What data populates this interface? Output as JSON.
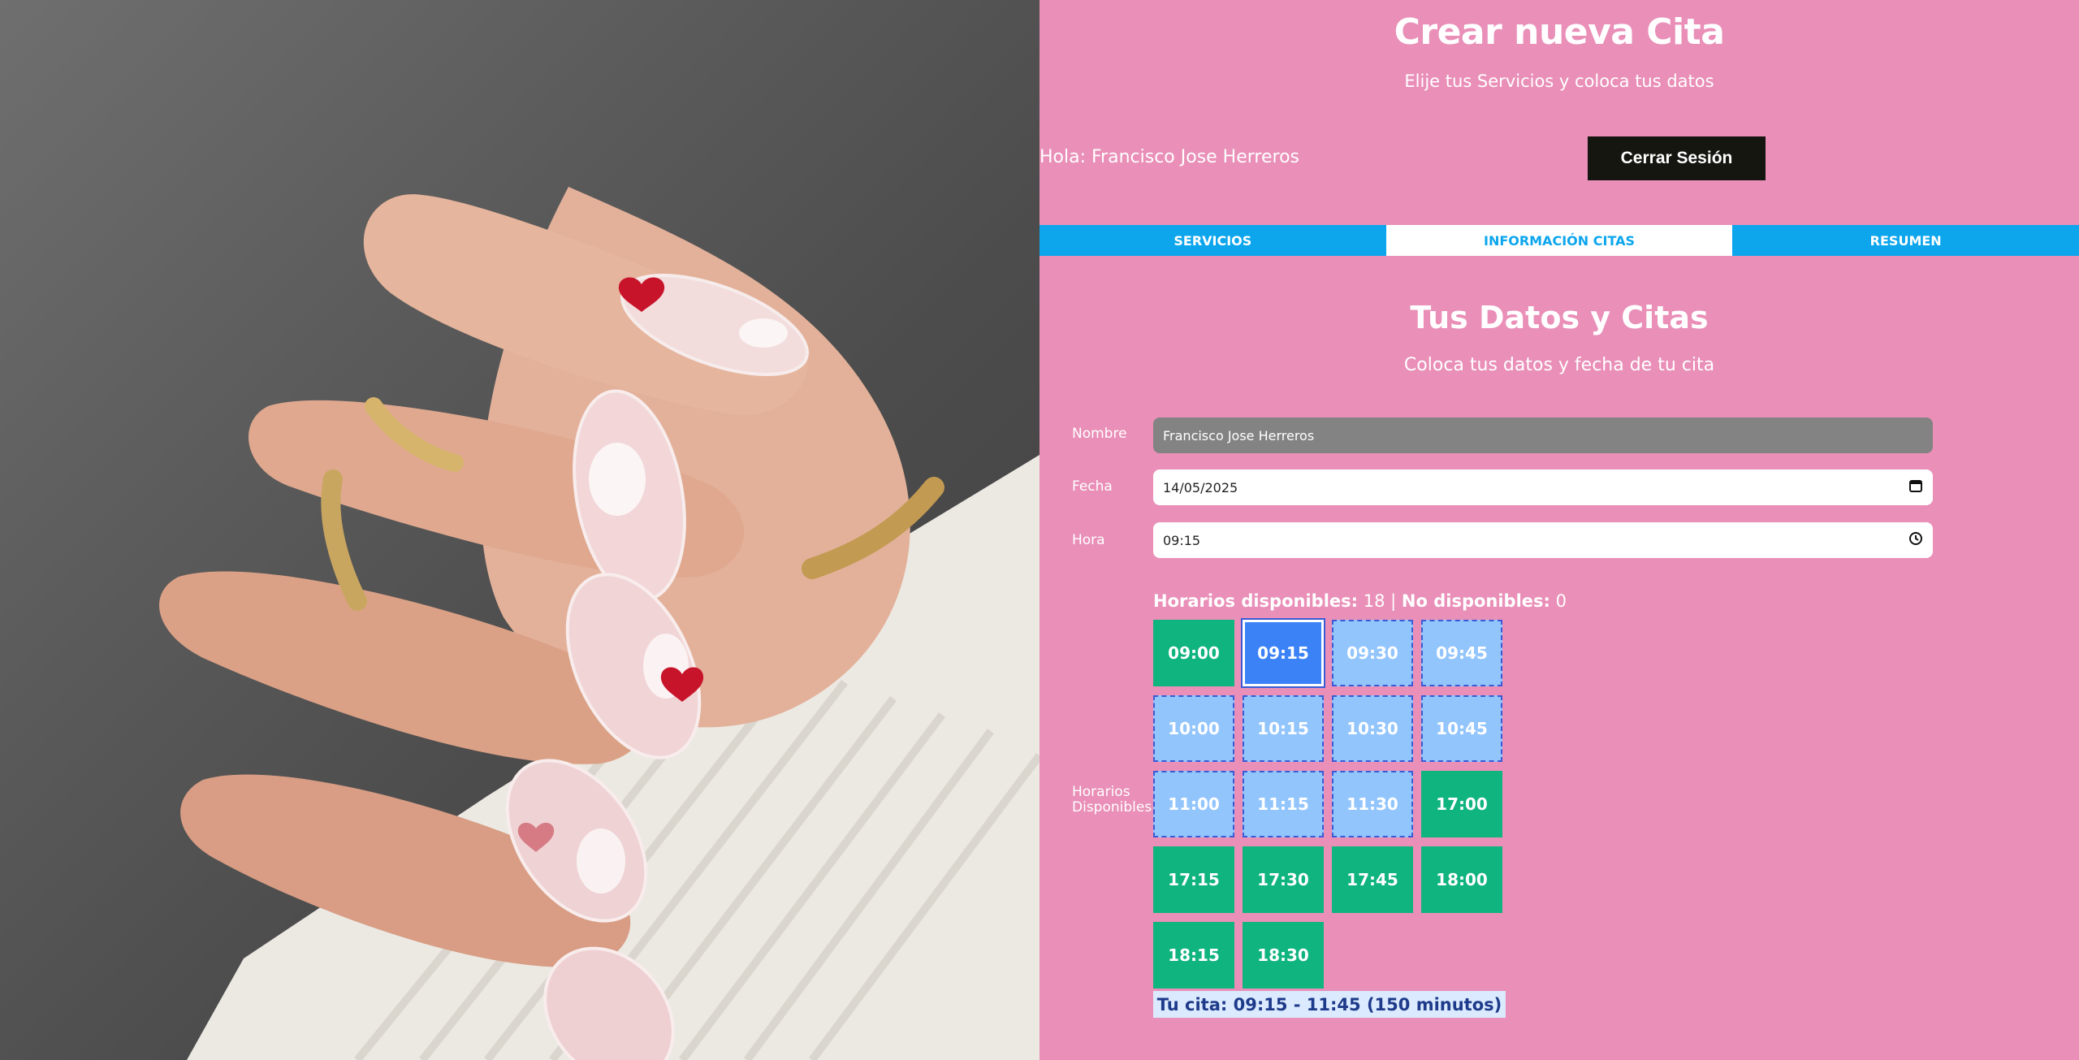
{
  "header": {
    "title": "Crear nueva Cita",
    "subtitle": "Elije tus Servicios y coloca tus datos",
    "greeting": "Hola: Francisco Jose Herreros",
    "logout_label": "Cerrar Sesión"
  },
  "tabs": [
    {
      "label": "Servicios",
      "active": false
    },
    {
      "label": "Información Citas",
      "active": true
    },
    {
      "label": "Resumen",
      "active": false
    }
  ],
  "section": {
    "title": "Tus Datos y Citas",
    "subtitle": "Coloca tus datos y fecha de tu cita"
  },
  "form": {
    "name_label": "Nombre",
    "name_value": "Francisco Jose Herreros",
    "date_label": "Fecha",
    "date_value": "14/05/2025",
    "time_label": "Hora",
    "time_value": "09:15",
    "slots_label": "Horarios Disponibles"
  },
  "availability": {
    "available_label": "Horarios disponibles:",
    "available_count": "18",
    "separator": "|",
    "unavailable_label": "No disponibles:",
    "unavailable_count": "0"
  },
  "slots": [
    {
      "time": "09:00",
      "state": "free"
    },
    {
      "time": "09:15",
      "state": "selected"
    },
    {
      "time": "09:30",
      "state": "in-range"
    },
    {
      "time": "09:45",
      "state": "in-range"
    },
    {
      "time": "10:00",
      "state": "in-range"
    },
    {
      "time": "10:15",
      "state": "in-range"
    },
    {
      "time": "10:30",
      "state": "in-range"
    },
    {
      "time": "10:45",
      "state": "in-range"
    },
    {
      "time": "11:00",
      "state": "in-range"
    },
    {
      "time": "11:15",
      "state": "in-range"
    },
    {
      "time": "11:30",
      "state": "in-range"
    },
    {
      "time": "17:00",
      "state": "free"
    },
    {
      "time": "17:15",
      "state": "free"
    },
    {
      "time": "17:30",
      "state": "free"
    },
    {
      "time": "17:45",
      "state": "free"
    },
    {
      "time": "18:00",
      "state": "free"
    },
    {
      "time": "18:15",
      "state": "free"
    },
    {
      "time": "18:30",
      "state": "free"
    }
  ],
  "appointment": {
    "label": "Tu cita:",
    "value": "09:15 - 11:45 (150 minutos)"
  },
  "colors": {
    "background": "#e98fb8",
    "tab": "#0da6ed",
    "free_slot": "#10b47e",
    "selected_slot": "#3b82f6",
    "range_slot": "#93c5fd",
    "logout": "#161611"
  },
  "icons": {
    "date_field": "calendar-icon",
    "time_field": "clock-icon"
  }
}
